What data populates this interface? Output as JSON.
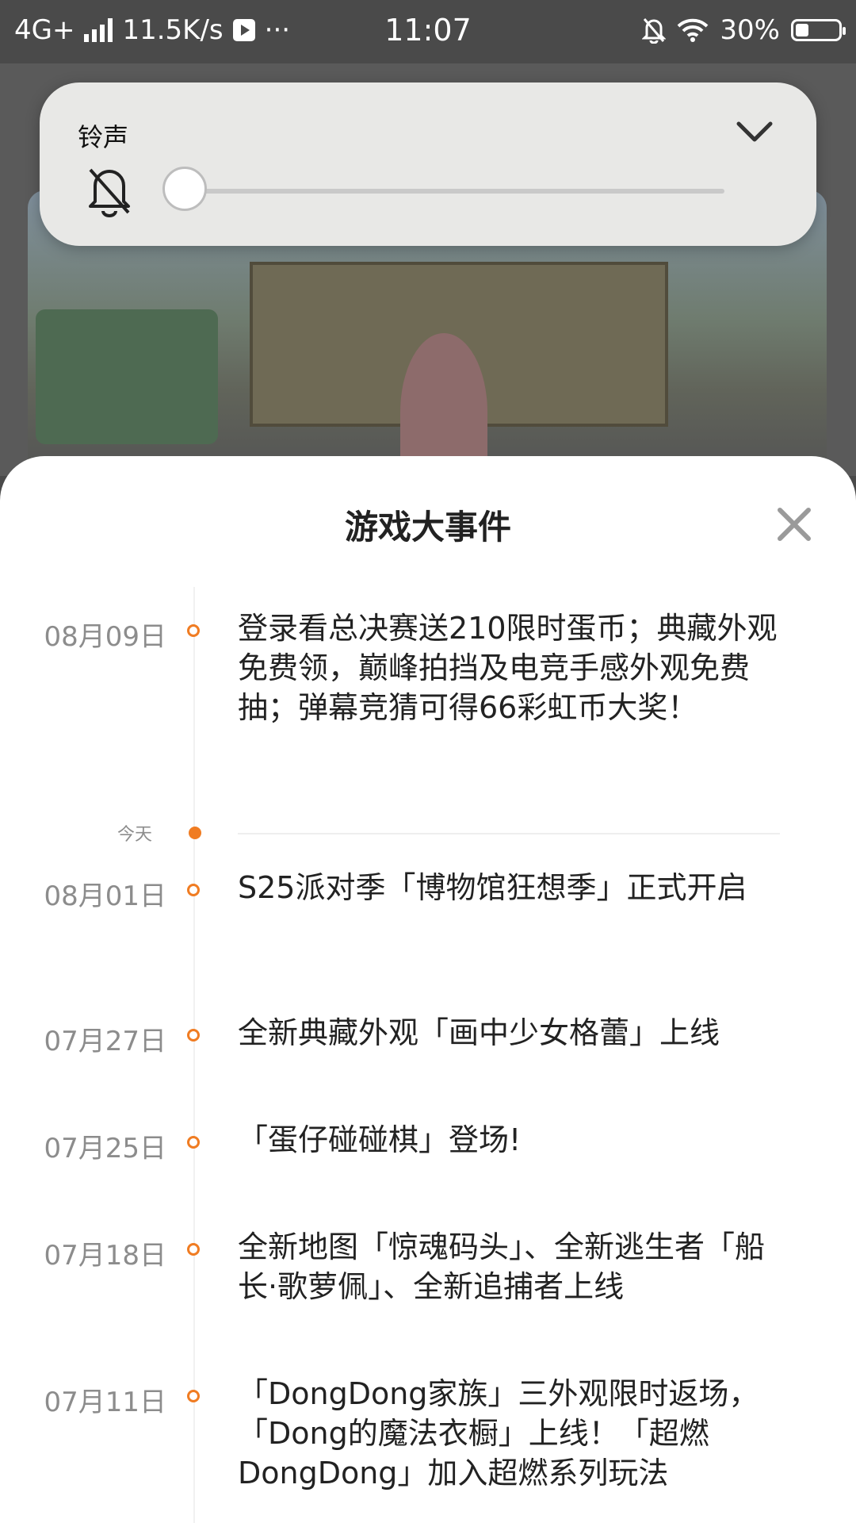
{
  "status_bar": {
    "network": "4G+",
    "speed": "11.5K/s",
    "more": "···",
    "time": "11:07",
    "battery_percent": "30%",
    "battery_level": 0.3,
    "icons": [
      "signal-bars-icon",
      "play-icon",
      "bell-muted-icon",
      "wifi-icon",
      "battery-icon"
    ]
  },
  "volume_panel": {
    "title": "铃声",
    "level": 0,
    "icons": [
      "bell-muted-icon",
      "chevron-down-icon"
    ]
  },
  "sheet": {
    "title": "游戏大事件",
    "today_label": "今天",
    "accent_color": "#f07c22",
    "events": [
      {
        "date": "08月09日",
        "text": "登录看总决赛送210限时蛋币；典藏外观免费领，巅峰拍挡及电竞手感外观免费抽；弹幕竞猜可得66彩虹币大奖！"
      },
      {
        "date": "08月01日",
        "text": "S25派对季「博物馆狂想季」正式开启"
      },
      {
        "date": "07月27日",
        "text": "全新典藏外观「画中少女格蕾」上线"
      },
      {
        "date": "07月25日",
        "text": "「蛋仔碰碰棋」登场!"
      },
      {
        "date": "07月18日",
        "text": "全新地图「惊魂码头」、全新逃生者「船长·歌萝佩」、全新追捕者上线"
      },
      {
        "date": "07月11日",
        "text": "「DongDong家族」三外观限时返场，「Dong的魔法衣橱」上线！「超燃DongDong」加入超燃系列玩法"
      }
    ]
  }
}
